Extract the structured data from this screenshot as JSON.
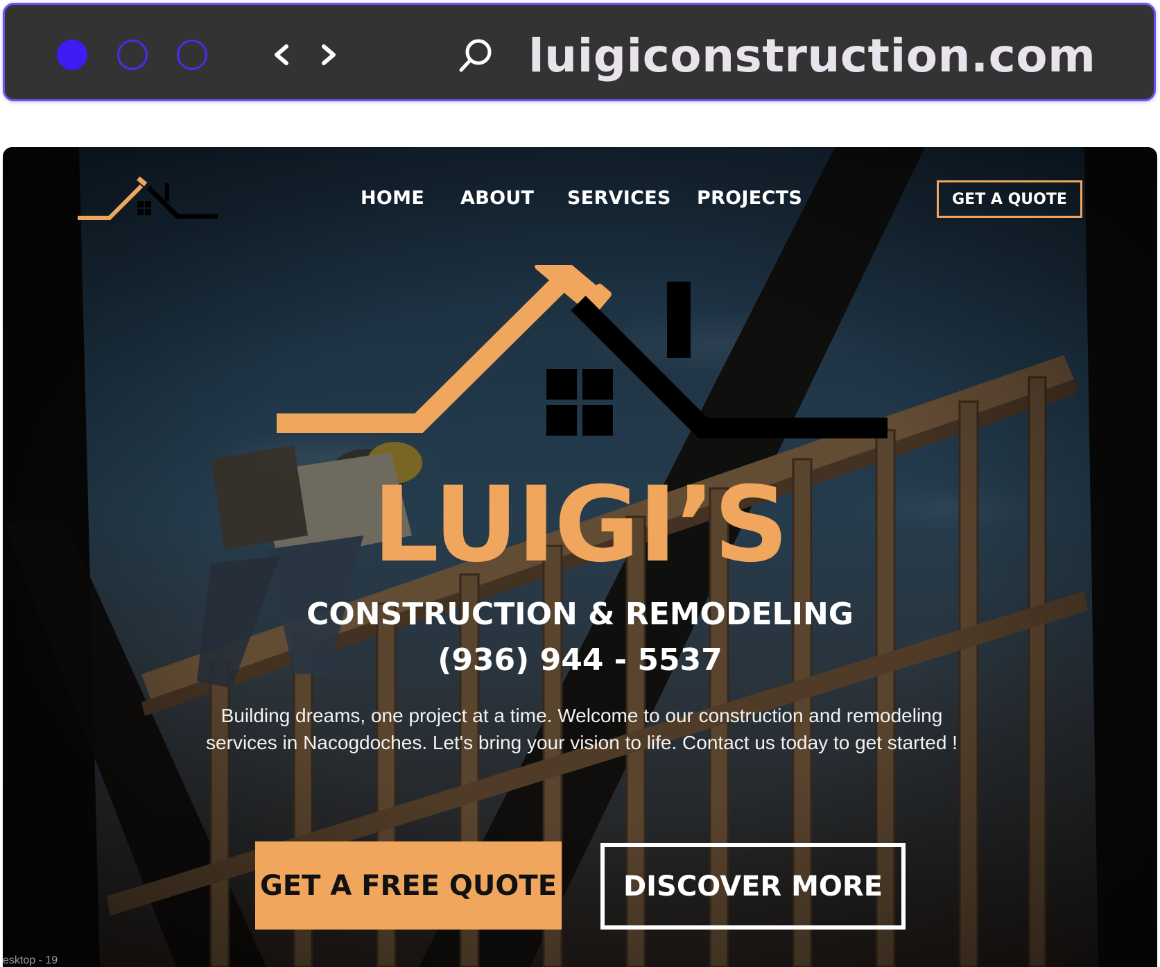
{
  "browser": {
    "url": "luigiconstruction.com",
    "accent_color": "#3e1cf6",
    "bar_color": "#333333",
    "icons": [
      "window-dot-filled",
      "window-dot-outline",
      "window-dot-outline",
      "chevron-left-icon",
      "chevron-right-icon",
      "search-icon"
    ]
  },
  "site": {
    "nav": {
      "items": [
        {
          "label": "HOME"
        },
        {
          "label": "ABOUT"
        },
        {
          "label": "SERVICES"
        },
        {
          "label": "PROJECTS"
        }
      ],
      "quote_button": "GET A QUOTE"
    },
    "hero": {
      "brand_name": "LUIGI’S",
      "tagline": "CONSTRUCTION & REMODELING",
      "phone": "(936) 944 - 5537",
      "intro": "Building dreams, one project at a time. Welcome to our construction and remodeling services in Nacogdoches. Let's bring your vision to life. Contact us today to get started !",
      "primary_cta": "GET A FREE QUOTE",
      "secondary_cta": "DISCOVER MORE"
    },
    "brand_color": "#f0a75d",
    "corner_label": "esktop - 19"
  }
}
